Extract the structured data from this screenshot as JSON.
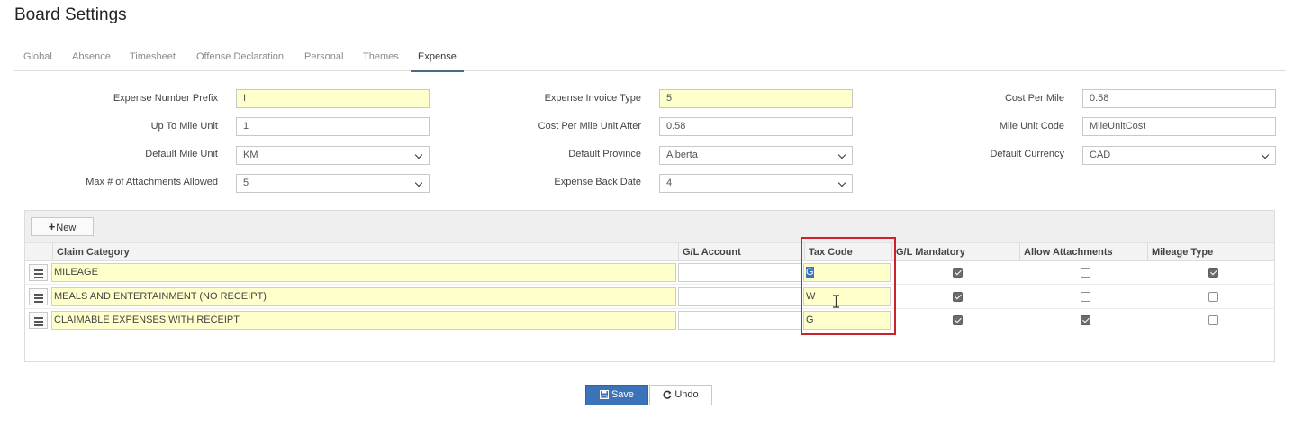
{
  "page_title": "Board Settings",
  "tabs": [
    {
      "label": "Global"
    },
    {
      "label": "Absence"
    },
    {
      "label": "Timesheet"
    },
    {
      "label": "Offense Declaration"
    },
    {
      "label": "Personal"
    },
    {
      "label": "Themes"
    },
    {
      "label": "Expense",
      "active": true
    }
  ],
  "form": {
    "expense_number_prefix": {
      "label": "Expense Number Prefix",
      "value": "I"
    },
    "up_to_mile_unit": {
      "label": "Up To Mile Unit",
      "value": "1"
    },
    "default_mile_unit": {
      "label": "Default Mile Unit",
      "value": "KM"
    },
    "max_attachments": {
      "label": "Max # of Attachments Allowed",
      "value": "5"
    },
    "expense_invoice_type": {
      "label": "Expense Invoice Type",
      "value": "5"
    },
    "cost_per_mile_unit_after": {
      "label": "Cost Per Mile Unit After",
      "value": "0.58"
    },
    "default_province": {
      "label": "Default Province",
      "value": "Alberta"
    },
    "expense_back_date": {
      "label": "Expense Back Date",
      "value": "4"
    },
    "cost_per_mile": {
      "label": "Cost Per Mile",
      "value": "0.58"
    },
    "mile_unit_code": {
      "label": "Mile Unit Code",
      "value": "MileUnitCost"
    },
    "default_currency": {
      "label": "Default Currency",
      "value": "CAD"
    }
  },
  "grid": {
    "new_button": "New",
    "columns": [
      "Claim Category",
      "G/L Account",
      "Tax Code",
      "G/L Mandatory",
      "Allow Attachments",
      "Mileage Type"
    ],
    "rows": [
      {
        "claim_category": "MILEAGE",
        "gl_account": "",
        "tax_code": "G",
        "gl_mandatory": true,
        "allow_attachments": false,
        "mileage_type": true
      },
      {
        "claim_category": "MEALS AND ENTERTAINMENT (NO RECEIPT)",
        "gl_account": "",
        "tax_code": "W",
        "gl_mandatory": true,
        "allow_attachments": false,
        "mileage_type": false
      },
      {
        "claim_category": "CLAIMABLE EXPENSES WITH RECEIPT",
        "gl_account": "",
        "tax_code": "G",
        "gl_mandatory": true,
        "allow_attachments": true,
        "mileage_type": false
      }
    ]
  },
  "actions": {
    "save": "Save",
    "undo": "Undo"
  },
  "colors": {
    "accent": "#3a73b8",
    "required_field": "#ffffcc",
    "highlight_border": "#d0202a"
  }
}
